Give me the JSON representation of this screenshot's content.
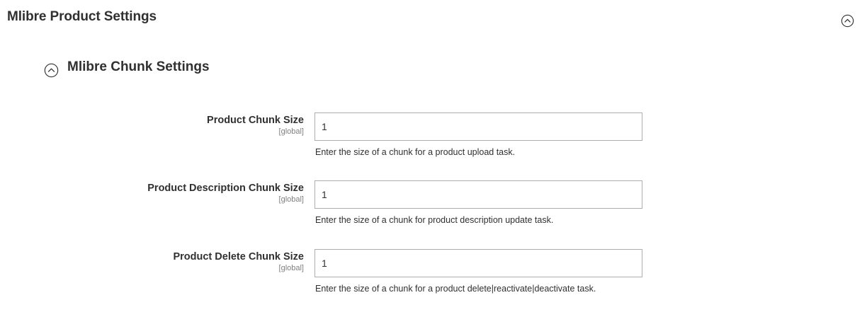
{
  "section": {
    "title": "Mlibre Product Settings",
    "collapse_icon": "chevron-up-circle-icon"
  },
  "group": {
    "title": "Mlibre Chunk Settings",
    "toggle_icon": "chevron-up-circle-icon"
  },
  "fields": [
    {
      "label": "Product Chunk Size",
      "scope": "[global]",
      "value": "1",
      "note": "Enter the size of a chunk for a product upload task."
    },
    {
      "label": "Product Description Chunk Size",
      "scope": "[global]",
      "value": "1",
      "note": "Enter the size of a chunk for product description update task."
    },
    {
      "label": "Product Delete Chunk Size",
      "scope": "[global]",
      "value": "1",
      "note": "Enter the size of a chunk for a product delete|reactivate|deactivate task."
    }
  ],
  "colors": {
    "text": "#303030",
    "scope_text": "#808080",
    "input_border": "#adadad",
    "background": "#ffffff"
  }
}
